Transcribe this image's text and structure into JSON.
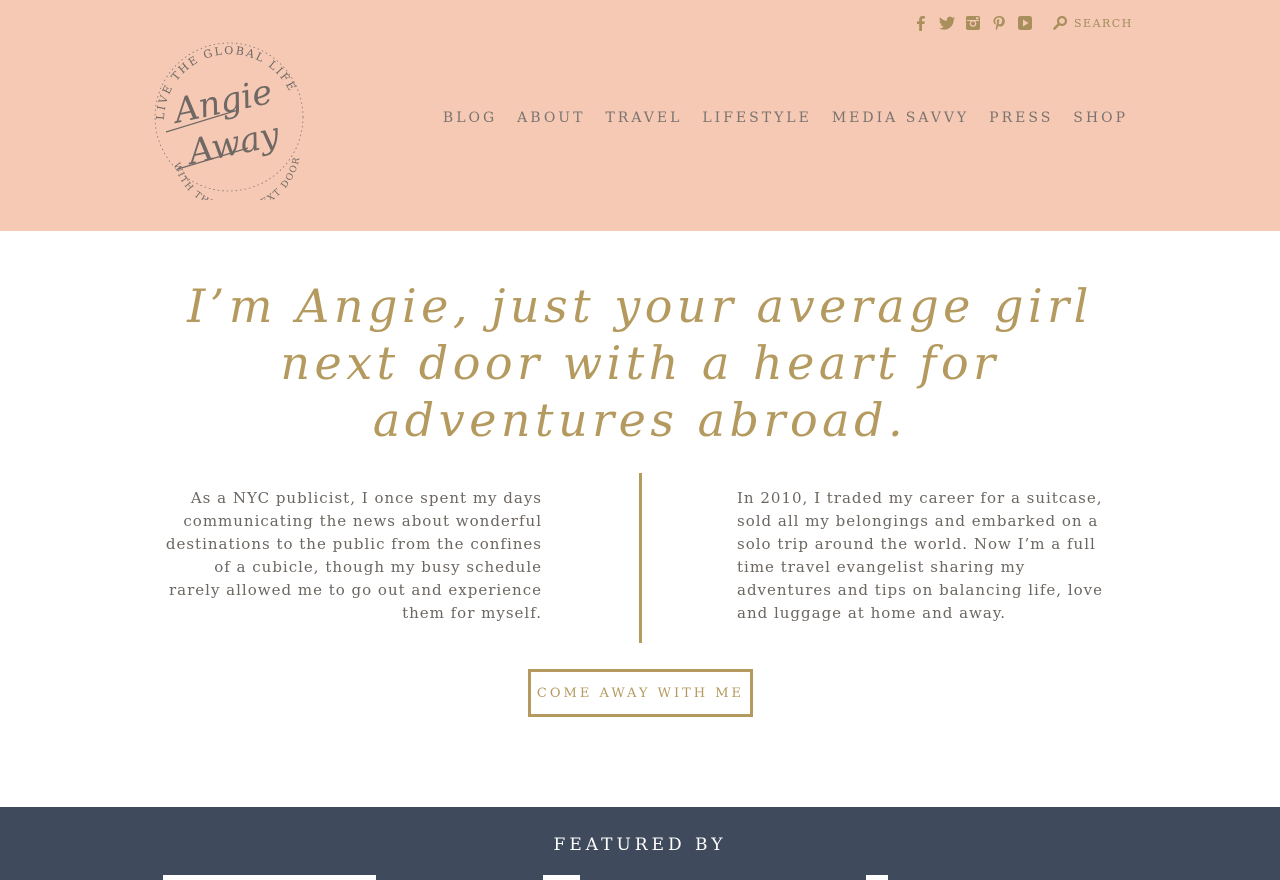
{
  "colors": {
    "header_bg": "#f6c9b4",
    "gold": "#b59a5f",
    "nav_text": "#7a7470",
    "body_text": "#6c6661",
    "featured_bg": "#3f4b5c"
  },
  "logo": {
    "arc_top": "LIVE THE GLOBAL LIFE",
    "script_line1": "Angie",
    "script_line2": "Away",
    "arc_bottom": "WITH THE GIRL NEXT DOOR"
  },
  "social": [
    {
      "name": "facebook-icon"
    },
    {
      "name": "twitter-icon"
    },
    {
      "name": "instagram-icon"
    },
    {
      "name": "pinterest-icon"
    },
    {
      "name": "youtube-icon"
    }
  ],
  "search": {
    "placeholder": "SEARCH"
  },
  "nav": {
    "items": [
      {
        "label": "BLOG"
      },
      {
        "label": "ABOUT"
      },
      {
        "label": "TRAVEL"
      },
      {
        "label": "LIFESTYLE"
      },
      {
        "label": "MEDIA SAVVY"
      },
      {
        "label": "PRESS"
      },
      {
        "label": "SHOP"
      }
    ]
  },
  "intro": {
    "headline_line1": "I’m Angie, just your average girl",
    "headline_line2": "next door with a heart for",
    "headline_line3": "adventures abroad.",
    "left_lines": [
      "As a NYC publicist, I once spent my days",
      "communicating the news about wonderful",
      "destinations to the public from the confines",
      "of a cubicle, though my busy schedule",
      "rarely allowed me to go out and experience",
      "them for myself."
    ],
    "right_lines": [
      "In 2010, I traded my career for a suitcase,",
      "sold all my belongings and embarked on a",
      "solo trip around the world. Now I’m a full",
      "time travel evangelist sharing my",
      "adventures and tips on balancing life, love",
      "and luggage at home and away."
    ],
    "cta_label": "COME AWAY WITH ME"
  },
  "featured": {
    "heading": "FEATURED BY"
  }
}
